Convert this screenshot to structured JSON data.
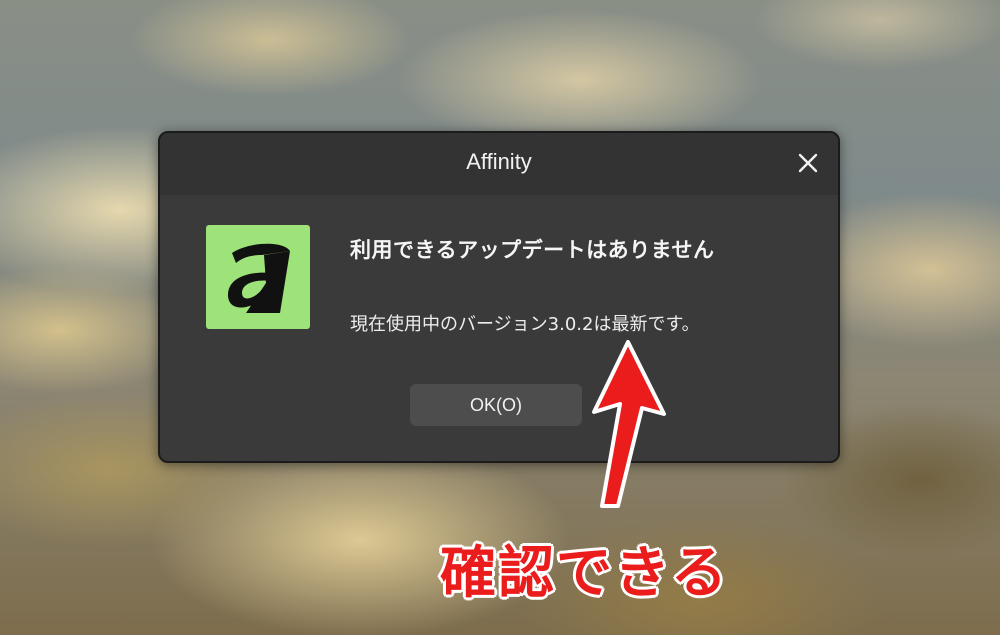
{
  "dialog": {
    "title": "Affinity",
    "heading": "利用できるアップデートはありません",
    "message": "現在使用中のバージョン3.0.2は最新です。",
    "ok_label": "OK(O)",
    "icon": "affinity-app-icon",
    "close_icon": "close-icon"
  },
  "annotation": {
    "text": "確認できる",
    "color": "#ea1c1c",
    "arrow_icon": "arrow-up-icon"
  },
  "colors": {
    "dialog_bg": "#3a3a3a",
    "titlebar_bg": "#333333",
    "button_bg": "#4d4d4d",
    "icon_bg": "#9ee27a"
  }
}
